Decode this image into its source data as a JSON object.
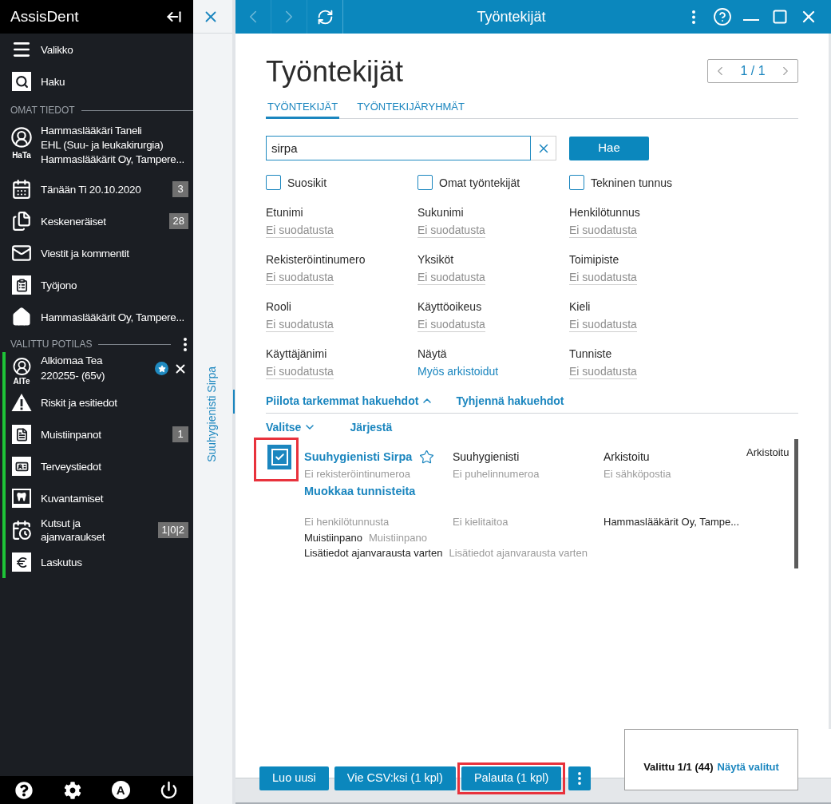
{
  "window": {
    "title": "Työntekijät",
    "back_disabled": true,
    "forward_disabled": true
  },
  "sidebar": {
    "app_name": "AssisDent",
    "top_items": [
      {
        "kind": "menu",
        "label": "Valikko"
      },
      {
        "kind": "search",
        "label": "Haku"
      }
    ],
    "own_heading": "OMAT TIEDOT",
    "user": {
      "initials": "HaTa",
      "lines": [
        "Hammaslääkäri Taneli",
        "EHL (Suu- ja leukakirurgia)",
        "Hammaslääkärit Oy, Tampere..."
      ]
    },
    "own_items": [
      {
        "kind": "calendar",
        "label": "Tänään Ti 20.10.2020",
        "badge": "3"
      },
      {
        "kind": "documents",
        "label": "Keskeneräiset",
        "badge": "28"
      },
      {
        "kind": "mail",
        "label": "Viestit ja kommentit"
      },
      {
        "kind": "queue",
        "label": "Työjono"
      },
      {
        "kind": "home",
        "label": "Hammaslääkärit Oy, Tampere..."
      }
    ],
    "patient_heading": "VALITTU POTILAS",
    "patient": {
      "initials": "AlTe",
      "name": "Alkiomaa Tea",
      "id": "220255- (65v)",
      "favorite": true
    },
    "patient_items": [
      {
        "kind": "warning",
        "label": "Riskit ja esitiedot"
      },
      {
        "kind": "notes",
        "label": "Muistiinpanot",
        "badge": "1"
      },
      {
        "kind": "health",
        "label": "Terveystiedot"
      },
      {
        "kind": "imaging",
        "label": "Kuvantamiset"
      },
      {
        "kind": "appointments",
        "label": "Kutsut ja ajanvaraukset",
        "badge": "1|0|2"
      },
      {
        "kind": "billing",
        "label": "Laskutus"
      }
    ],
    "profile_letter": "A"
  },
  "side_panel": {
    "tab_label": "Suuhygienisti Sirpa"
  },
  "page": {
    "heading": "Työntekijät",
    "pager": "1 / 1",
    "tabs": [
      {
        "label": "TYÖNTEKIJÄT",
        "selected": true
      },
      {
        "label": "TYÖNTEKIJÄRYHMÄT",
        "selected": false
      }
    ],
    "search": {
      "value": "sirpa"
    },
    "search_button": "Hae",
    "checkboxes": [
      {
        "label": "Suosikit",
        "checked": false
      },
      {
        "label": "Omat työntekijät",
        "checked": false
      },
      {
        "label": "Tekninen tunnus",
        "checked": false
      }
    ],
    "filters": [
      {
        "label": "Etunimi",
        "value": "Ei suodatusta",
        "filtered": false
      },
      {
        "label": "Sukunimi",
        "value": "Ei suodatusta",
        "filtered": false
      },
      {
        "label": "Henkilötunnus",
        "value": "Ei suodatusta",
        "filtered": false
      },
      {
        "label": "Rekisteröintinumero",
        "value": "Ei suodatusta",
        "filtered": false
      },
      {
        "label": "Yksiköt",
        "value": "Ei suodatusta",
        "filtered": false
      },
      {
        "label": "Toimipiste",
        "value": "Ei suodatusta",
        "filtered": false
      },
      {
        "label": "Rooli",
        "value": "Ei suodatusta",
        "filtered": false
      },
      {
        "label": "Käyttöoikeus",
        "value": "Ei suodatusta",
        "filtered": false
      },
      {
        "label": "Kieli",
        "value": "Ei suodatusta",
        "filtered": false
      },
      {
        "label": "Käyttäjänimi",
        "value": "Ei suodatusta",
        "filtered": false
      },
      {
        "label": "Näytä",
        "value": "Myös arkistoidut",
        "filtered": true
      },
      {
        "label": "Tunniste",
        "value": "Ei suodatusta",
        "filtered": false
      }
    ],
    "toggle_link": "Piilota tarkemmat hakuehdot",
    "clear_link": "Tyhjennä hakuehdot",
    "select_menu": "Valitse",
    "sort_link": "Järjestä",
    "results": [
      {
        "selected": true,
        "highlighted": true,
        "name": "Suuhygienisti Sirpa",
        "favorite": false,
        "role": "Suuhygienisti",
        "status": "Arkistoitu",
        "state_tag": "Arkistoitu",
        "registration": "Ei rekisteröintinumeroa",
        "phone": "Ei puhelinnumeroa",
        "email": "Ei sähköpostia",
        "edit_link": "Muokkaa tunnisteita",
        "ssn": "Ei henkilötunnusta",
        "languages": "Ei kielitaitoa",
        "office": "Hammaslääkärit Oy, Tampe...",
        "note": {
          "label": "Muistiinpano",
          "value": "Muistiinpano"
        },
        "booking_info": {
          "label": "Lisätiedot ajanvarausta varten",
          "value": "Lisätiedot ajanvarausta varten"
        }
      }
    ]
  },
  "footer": {
    "buttons": [
      {
        "label": "Luo uusi",
        "highlighted": false
      },
      {
        "label": "Vie CSV:ksi (1 kpl)",
        "highlighted": false
      },
      {
        "label": "Palauta (1 kpl)",
        "highlighted": true
      }
    ],
    "selection": {
      "text": "Valittu 1/1 (44)",
      "link": "Näytä valitut"
    }
  }
}
